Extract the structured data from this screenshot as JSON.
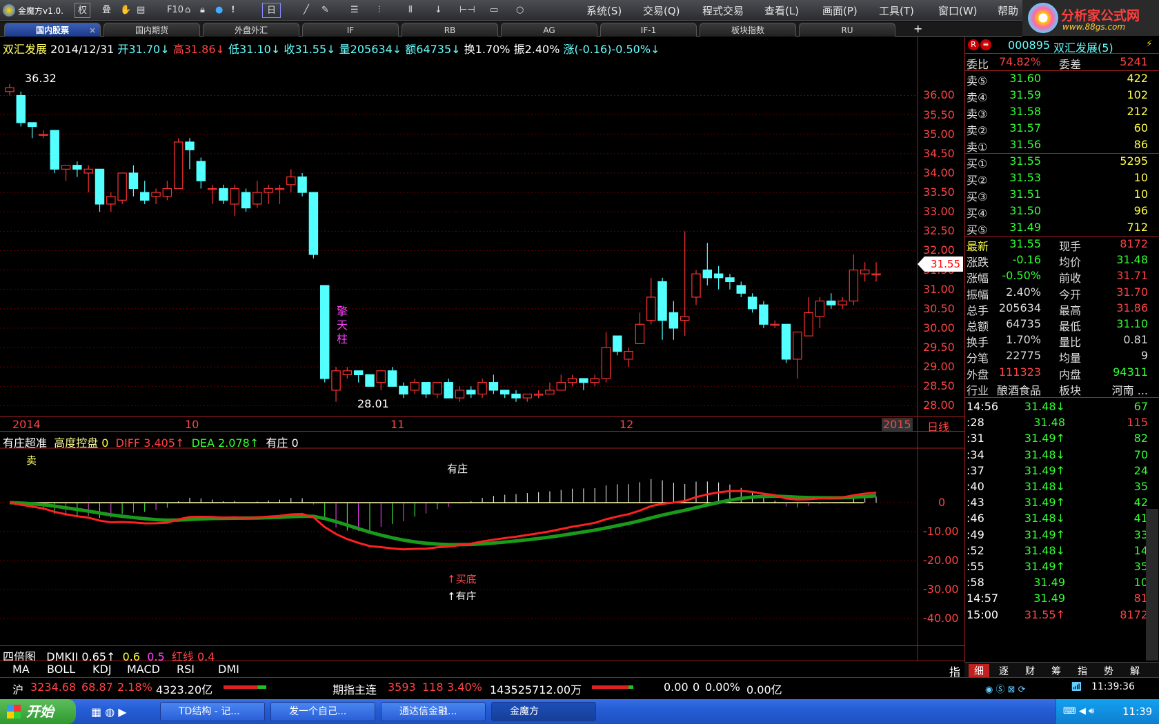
{
  "app": {
    "title": "金魔方v1.0.",
    "menus": [
      "系统(S)",
      "交易(Q)",
      "程式交易",
      "查看(L)",
      "画面(P)",
      "工具(T)",
      "窗口(W)",
      "帮助"
    ],
    "toolbar": {
      "quan": "权",
      "die": "叠",
      "f10": "F10",
      "ri": "日"
    },
    "logo_text": "分析家公式网",
    "logo_url": "www.88gs.com"
  },
  "tabs": [
    "国内股票",
    "国内期货",
    "外盘外汇",
    "IF",
    "RB",
    "AG",
    "IF-1",
    "板块指数",
    "RU"
  ],
  "header": {
    "name": "双汇发展",
    "date": "2014/12/31",
    "open": "开31.70↓",
    "high": "高31.86↓",
    "low": "低31.10↓",
    "close": "收31.55↓",
    "vol": "量205634↓",
    "amount": "额64735↓",
    "turnover": "换1.70%",
    "amplitude": "振2.40%",
    "change": "涨(-0.16)-0.50%↓"
  },
  "chart_data": {
    "type": "candlestick",
    "price_axis": [
      "36.00",
      "35.50",
      "35.00",
      "34.50",
      "34.00",
      "33.50",
      "33.00",
      "32.50",
      "32.00",
      "31.50",
      "31.00",
      "30.50",
      "30.00",
      "29.50",
      "29.00",
      "28.50",
      "28.00"
    ],
    "ylim": [
      27.9,
      36.4
    ],
    "high_label": "36.32",
    "low_label": "28.01",
    "last_price_tag": "31.55",
    "annotation": "擎天柱",
    "x_labels": [
      "2014",
      "10",
      "11",
      "12",
      "2015"
    ],
    "period": "日线",
    "candles": [
      [
        36.1,
        36.2,
        36.0,
        36.3
      ],
      [
        36.0,
        35.3,
        35.2,
        36.1
      ],
      [
        35.3,
        35.2,
        34.9,
        35.3
      ],
      [
        35.0,
        35.0,
        34.9,
        35.1
      ],
      [
        35.1,
        34.1,
        34.0,
        35.1
      ],
      [
        34.1,
        34.2,
        33.8,
        34.2
      ],
      [
        34.2,
        34.1,
        33.9,
        34.3
      ],
      [
        34.0,
        34.1,
        33.5,
        34.2
      ],
      [
        34.1,
        33.2,
        33.0,
        34.1
      ],
      [
        33.2,
        33.4,
        33.0,
        33.5
      ],
      [
        33.3,
        34.0,
        33.2,
        34.0
      ],
      [
        34.0,
        33.6,
        33.4,
        34.2
      ],
      [
        33.5,
        33.3,
        33.2,
        33.8
      ],
      [
        33.4,
        33.5,
        33.2,
        33.6
      ],
      [
        33.4,
        33.6,
        33.3,
        33.8
      ],
      [
        33.6,
        34.8,
        33.6,
        34.9
      ],
      [
        34.8,
        34.6,
        34.1,
        34.9
      ],
      [
        34.3,
        33.8,
        33.6,
        34.4
      ],
      [
        33.6,
        33.6,
        33.2,
        33.7
      ],
      [
        33.6,
        33.3,
        33.2,
        33.7
      ],
      [
        33.2,
        33.6,
        32.9,
        33.7
      ],
      [
        33.5,
        33.1,
        33.0,
        33.6
      ],
      [
        33.2,
        33.5,
        33.1,
        33.8
      ],
      [
        33.5,
        33.6,
        33.2,
        33.7
      ],
      [
        33.6,
        33.6,
        33.2,
        33.7
      ],
      [
        33.7,
        33.9,
        33.5,
        34.1
      ],
      [
        33.9,
        33.5,
        33.4,
        34.0
      ],
      [
        33.5,
        31.9,
        31.8,
        33.5
      ],
      [
        31.1,
        28.7,
        28.6,
        31.1
      ],
      [
        28.4,
        28.9,
        28.1,
        29.0
      ],
      [
        28.8,
        28.9,
        28.7,
        29.0
      ],
      [
        28.9,
        28.8,
        28.6,
        28.9
      ],
      [
        28.8,
        28.5,
        28.5,
        28.8
      ],
      [
        28.6,
        28.9,
        28.4,
        28.9
      ],
      [
        28.9,
        28.5,
        28.5,
        29.0
      ],
      [
        28.5,
        28.3,
        28.2,
        28.6
      ],
      [
        28.4,
        28.6,
        28.3,
        28.7
      ],
      [
        28.6,
        28.3,
        28.2,
        28.6
      ],
      [
        28.3,
        28.6,
        28.2,
        28.6
      ],
      [
        28.6,
        28.2,
        28.2,
        28.7
      ],
      [
        28.2,
        28.4,
        28.1,
        28.5
      ],
      [
        28.4,
        28.3,
        28.2,
        28.5
      ],
      [
        28.3,
        28.6,
        28.2,
        28.7
      ],
      [
        28.6,
        28.4,
        28.3,
        28.8
      ],
      [
        28.4,
        28.3,
        28.2,
        28.4
      ],
      [
        28.3,
        28.2,
        28.1,
        28.4
      ],
      [
        28.2,
        28.3,
        28.1,
        28.3
      ],
      [
        28.3,
        28.3,
        28.2,
        28.4
      ],
      [
        28.3,
        28.4,
        28.3,
        28.6
      ],
      [
        28.4,
        28.6,
        28.4,
        28.8
      ],
      [
        28.6,
        28.7,
        28.5,
        28.8
      ],
      [
        28.7,
        28.6,
        28.4,
        28.7
      ],
      [
        28.6,
        28.7,
        28.5,
        28.8
      ],
      [
        28.7,
        29.5,
        28.6,
        29.9
      ],
      [
        29.8,
        29.4,
        29.3,
        29.8
      ],
      [
        29.2,
        29.4,
        29.0,
        29.5
      ],
      [
        29.6,
        30.1,
        29.6,
        30.4
      ],
      [
        30.2,
        30.8,
        30.1,
        31.3
      ],
      [
        31.2,
        30.2,
        29.7,
        31.3
      ],
      [
        30.4,
        30.0,
        29.7,
        30.7
      ],
      [
        30.2,
        30.3,
        29.8,
        32.5
      ],
      [
        30.8,
        31.4,
        30.6,
        31.5
      ],
      [
        31.5,
        31.3,
        31.1,
        32.2
      ],
      [
        31.4,
        31.3,
        31.0,
        31.6
      ],
      [
        31.3,
        31.2,
        31.0,
        31.4
      ],
      [
        31.1,
        30.9,
        30.8,
        31.2
      ],
      [
        30.8,
        30.5,
        30.4,
        30.9
      ],
      [
        30.6,
        30.1,
        30.0,
        30.7
      ],
      [
        30.1,
        30.1,
        30.0,
        30.2
      ],
      [
        30.1,
        29.2,
        29.1,
        30.1
      ],
      [
        29.2,
        29.9,
        28.7,
        29.9
      ],
      [
        29.8,
        30.4,
        29.8,
        30.8
      ],
      [
        30.3,
        30.7,
        30.0,
        30.8
      ],
      [
        30.7,
        30.6,
        30.5,
        30.9
      ],
      [
        30.6,
        30.7,
        30.5,
        30.8
      ],
      [
        30.7,
        31.5,
        30.6,
        31.9
      ],
      [
        31.4,
        31.5,
        31.2,
        31.7
      ],
      [
        31.4,
        31.4,
        31.2,
        31.7
      ]
    ]
  },
  "macd_panel": {
    "name": "有庄超准",
    "label2": "高度控盘",
    "label2_val": "0",
    "diff": "DIFF 3.405↑",
    "dea": "DEA 2.078↑",
    "label3": "有庄",
    "label3_val": "0",
    "axis": [
      "0",
      "-10.00",
      "-20.00",
      "-30.00",
      "-40.00"
    ],
    "ann_sell": "卖",
    "ann_zhuang": "有庄",
    "ann_bottom": "↑买底",
    "ann_zhuang2": "↑有庄"
  },
  "dmk_panel": {
    "name": "四倍图",
    "dmk": "DMKII 0.65↑",
    "v1": "0.6",
    "v2": "0.5",
    "red": "红线 0.4"
  },
  "indicator_tabs": [
    "MA",
    "BOLL",
    "KDJ",
    "MACD",
    "RSI",
    "DMI"
  ],
  "indicator_right": "指",
  "quote": {
    "code": "000895",
    "name": "双汇发展(5)",
    "weibi_label": "委比",
    "weibi": "74.82%",
    "weicha_label": "委差",
    "weicha": "5241",
    "sells": [
      {
        "label": "卖⑤",
        "price": "31.60",
        "vol": "422"
      },
      {
        "label": "卖④",
        "price": "31.59",
        "vol": "102"
      },
      {
        "label": "卖③",
        "price": "31.58",
        "vol": "212"
      },
      {
        "label": "卖②",
        "price": "31.57",
        "vol": "60"
      },
      {
        "label": "卖①",
        "price": "31.56",
        "vol": "86"
      }
    ],
    "buys": [
      {
        "label": "买①",
        "price": "31.55",
        "vol": "5295"
      },
      {
        "label": "买②",
        "price": "31.53",
        "vol": "10"
      },
      {
        "label": "买③",
        "price": "31.51",
        "vol": "10"
      },
      {
        "label": "买④",
        "price": "31.50",
        "vol": "96"
      },
      {
        "label": "买⑤",
        "price": "31.49",
        "vol": "712"
      }
    ],
    "stats": [
      {
        "l1": "最新",
        "v1": "31.55",
        "l2": "现手",
        "v2": "8172"
      },
      {
        "l1": "涨跌",
        "v1": "-0.16",
        "l2": "均价",
        "v2": "31.48"
      },
      {
        "l1": "涨幅",
        "v1": "-0.50%",
        "l2": "前收",
        "v2": "31.71"
      },
      {
        "l1": "振幅",
        "v1": "2.40%",
        "l2": "今开",
        "v2": "31.70"
      },
      {
        "l1": "总手",
        "v1": "205634",
        "l2": "最高",
        "v2": "31.86"
      },
      {
        "l1": "总额",
        "v1": "64735",
        "l2": "最低",
        "v2": "31.10"
      },
      {
        "l1": "换手",
        "v1": "1.70%",
        "l2": "量比",
        "v2": "0.81"
      },
      {
        "l1": "分笔",
        "v1": "22775",
        "l2": "均量",
        "v2": "9"
      },
      {
        "l1": "外盘",
        "v1": "111323",
        "l2": "内盘",
        "v2": "94311"
      },
      {
        "l1": "行业",
        "v1": "酿酒食品",
        "l2": "板块",
        "v2": "河南 ..."
      }
    ],
    "ticks": [
      {
        "t": "14:56",
        "p": "31.48↓",
        "v": "67"
      },
      {
        "t": ":28",
        "p": "31.48",
        "v": "115"
      },
      {
        "t": ":31",
        "p": "31.49↑",
        "v": "82"
      },
      {
        "t": ":34",
        "p": "31.48↓",
        "v": "70"
      },
      {
        "t": ":37",
        "p": "31.49↑",
        "v": "24"
      },
      {
        "t": ":40",
        "p": "31.48↓",
        "v": "35"
      },
      {
        "t": ":43",
        "p": "31.49↑",
        "v": "42"
      },
      {
        "t": ":46",
        "p": "31.48↓",
        "v": "41"
      },
      {
        "t": ":49",
        "p": "31.49↑",
        "v": "33"
      },
      {
        "t": ":52",
        "p": "31.48↓",
        "v": "14"
      },
      {
        "t": ":55",
        "p": "31.49↑",
        "v": "35"
      },
      {
        "t": ":58",
        "p": "31.49",
        "v": "10"
      },
      {
        "t": "14:57",
        "p": "31.49",
        "v": "81"
      },
      {
        "t": "15:00",
        "p": "31.55↑",
        "v": "8172"
      }
    ],
    "bottom_tabs": [
      "细",
      "逐",
      "财",
      "筹",
      "指",
      "势",
      "解"
    ]
  },
  "status": {
    "sh_label": "沪",
    "sh_idx": "3234.68",
    "sh_chg": "68.87",
    "sh_pct": "2.18%",
    "sh_amt": "4323.20亿",
    "fut_label": "期指主连",
    "fut_p": "3593",
    "fut_chg": "118",
    "fut_pct": "3.40%",
    "fut_amt": "143525712.00万",
    "x1": "0.00",
    "x2": "0",
    "x3": "0.00%",
    "x4": "0.00亿",
    "clock": "11:39:36"
  },
  "taskbar": {
    "start": "开始",
    "tasks": [
      "TD结构 - 记...",
      "发一个自己...",
      "通达信金融...",
      "金魔方"
    ],
    "time": "11:39"
  }
}
